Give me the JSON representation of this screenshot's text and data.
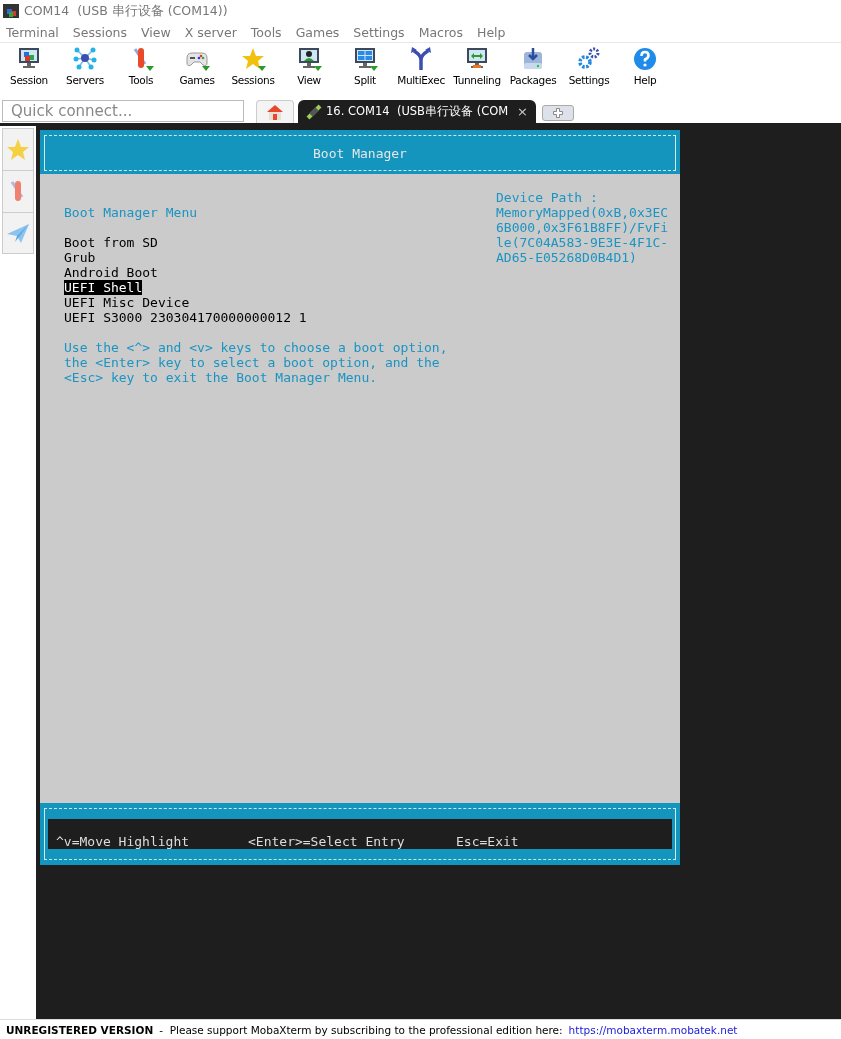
{
  "window": {
    "title": "COM14  (USB 串行设备 (COM14))"
  },
  "menu": [
    "Terminal",
    "Sessions",
    "View",
    "X server",
    "Tools",
    "Games",
    "Settings",
    "Macros",
    "Help"
  ],
  "toolbar": [
    {
      "label": "Session"
    },
    {
      "label": "Servers"
    },
    {
      "label": "Tools"
    },
    {
      "label": "Games"
    },
    {
      "label": "Sessions"
    },
    {
      "label": "View"
    },
    {
      "label": "Split"
    },
    {
      "label": "MultiExec"
    },
    {
      "label": "Tunneling"
    },
    {
      "label": "Packages"
    },
    {
      "label": "Settings"
    },
    {
      "label": "Help"
    }
  ],
  "quick_connect": {
    "placeholder": "Quick connect..."
  },
  "tabs": [
    {
      "kind": "home",
      "selected": false
    },
    {
      "kind": "session",
      "label": "16. COM14  (USB串行设备 (COM",
      "close": "×",
      "selected": true
    },
    {
      "kind": "new",
      "selected": false
    }
  ],
  "terminal": {
    "header": "Boot Manager",
    "menu_title": "Boot Manager Menu",
    "entries": [
      {
        "label": "Boot from SD",
        "selected": false
      },
      {
        "label": "Grub",
        "selected": false
      },
      {
        "label": "Android Boot",
        "selected": false
      },
      {
        "label": "UEFI Shell",
        "selected": true
      },
      {
        "label": "UEFI Misc Device",
        "selected": false
      },
      {
        "label": "UEFI S3000 230304170000000012 1",
        "selected": false
      }
    ],
    "help_lines": [
      "Use the <^> and <v> keys to choose a boot option,",
      "the <Enter> key to select a boot option, and the",
      "<Esc> key to exit the Boot Manager Menu."
    ],
    "device_path": [
      "Device Path :",
      "MemoryMapped(0xB,0x3EC",
      "6B000,0x3F61B8FF)/FvFi",
      "le(7C04A583-9E3E-4F1C-",
      "AD65-E05268D0B4D1)"
    ],
    "hotkeys": [
      "^v=Move Highlight",
      "<Enter>=Select Entry",
      "Esc=Exit"
    ]
  },
  "status_bar": {
    "notice": "UNREGISTERED VERSION",
    "message": "-  Please support MobaXterm by subscribing to the professional edition here:",
    "link": "https://mobaxterm.mobatek.net"
  }
}
